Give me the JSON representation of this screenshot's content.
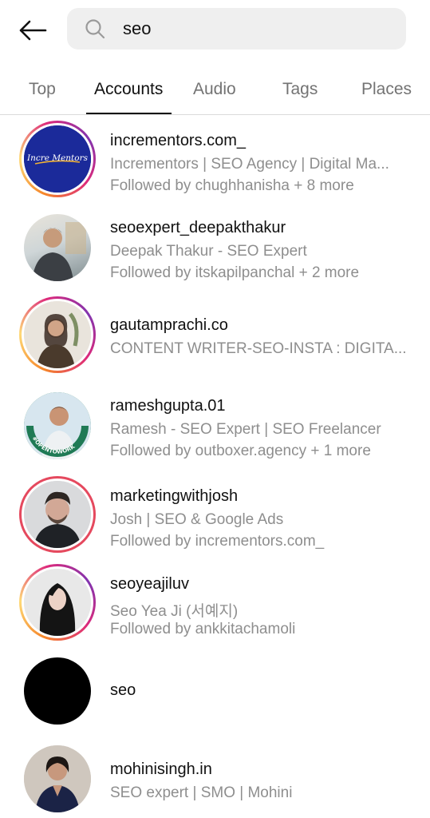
{
  "search": {
    "value": "seo"
  },
  "tabs": [
    {
      "label": "Top"
    },
    {
      "label": "Accounts"
    },
    {
      "label": "Audio"
    },
    {
      "label": "Tags"
    },
    {
      "label": "Places"
    }
  ],
  "accounts": [
    {
      "username": "incrementors.com_",
      "fullname": "Incrementors | SEO Agency | Digital Ma...",
      "followed": "Followed by chughhanisha + 8 more",
      "logo_text": "Incre Mentors"
    },
    {
      "username": "seoexpert_deepakthakur",
      "fullname": "Deepak Thakur - SEO Expert",
      "followed": "Followed by itskapilpanchal + 2 more"
    },
    {
      "username": "gautamprachi.co",
      "fullname": "CONTENT WRITER-SEO-INSTA : DIGITA..."
    },
    {
      "username": "rameshgupta.01",
      "fullname": "Ramesh - SEO Expert | SEO Freelancer",
      "followed": "Followed by outboxer.agency + 1 more",
      "badge_text": "#OPENTOWORK"
    },
    {
      "username": "marketingwithjosh",
      "fullname": "Josh | SEO & Google Ads",
      "followed": "Followed by incrementors.com_"
    },
    {
      "username": "seoyeajiluv",
      "fullname": "Seo Yea Ji (서예지)",
      "followed": "Followed by ankkitachamoli"
    },
    {
      "username": "seo"
    },
    {
      "username": "mohinisingh.in",
      "fullname": "SEO expert | SMO | Mohini"
    }
  ]
}
